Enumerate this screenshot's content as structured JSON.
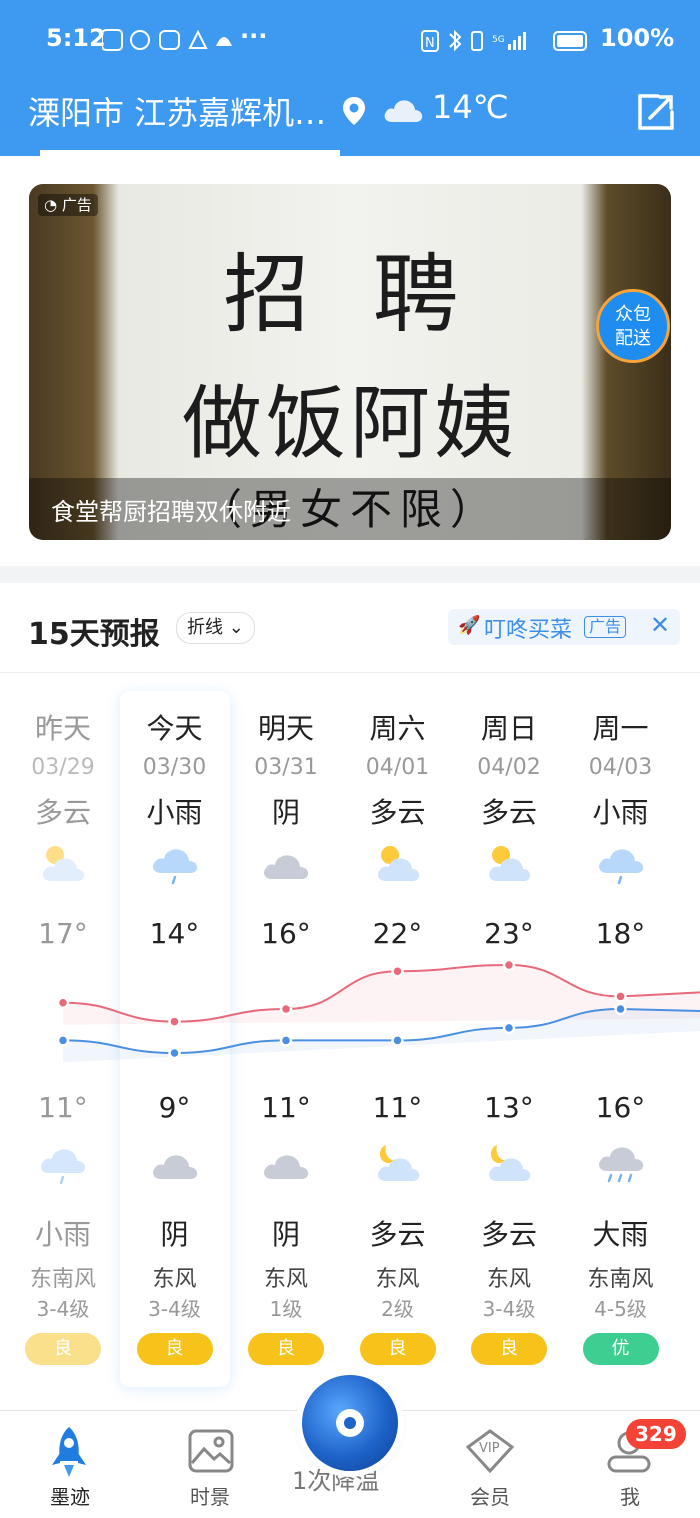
{
  "status_bar": {
    "time": "5:12",
    "more": "···",
    "battery": "100%"
  },
  "header": {
    "location": "溧阳市 江苏嘉辉机…",
    "temperature": "14℃"
  },
  "ad": {
    "tag": "广告",
    "line1": "招  聘",
    "line2": "做饭阿姨",
    "line3": "（男女不限）",
    "caption": "食堂帮厨招聘双休附近",
    "badge_line1": "众包",
    "badge_line2": "配送"
  },
  "forecast": {
    "title": "15天预报",
    "view_mode": "折线",
    "promo_text": "叮咚买菜",
    "promo_tag": "广告",
    "days": [
      {
        "name": "昨天",
        "date": "03/29",
        "day_cond": "多云",
        "high": "17°",
        "low": "11°",
        "night_cond": "小雨",
        "wind_dir": "东南风",
        "wind_level": "3-4级",
        "aqi": "良",
        "day_icon": "partly-cloudy-icon",
        "night_icon": "light-rain-icon"
      },
      {
        "name": "今天",
        "date": "03/30",
        "day_cond": "小雨",
        "high": "14°",
        "low": "9°",
        "night_cond": "阴",
        "wind_dir": "东风",
        "wind_level": "3-4级",
        "aqi": "良",
        "day_icon": "light-rain-icon",
        "night_icon": "overcast-icon"
      },
      {
        "name": "明天",
        "date": "03/31",
        "day_cond": "阴",
        "high": "16°",
        "low": "11°",
        "night_cond": "阴",
        "wind_dir": "东风",
        "wind_level": "1级",
        "aqi": "良",
        "day_icon": "overcast-icon",
        "night_icon": "overcast-icon"
      },
      {
        "name": "周六",
        "date": "04/01",
        "day_cond": "多云",
        "high": "22°",
        "low": "11°",
        "night_cond": "多云",
        "wind_dir": "东风",
        "wind_level": "2级",
        "aqi": "良",
        "day_icon": "partly-cloudy-icon",
        "night_icon": "cloudy-night-icon"
      },
      {
        "name": "周日",
        "date": "04/02",
        "day_cond": "多云",
        "high": "23°",
        "low": "13°",
        "night_cond": "多云",
        "wind_dir": "东风",
        "wind_level": "3-4级",
        "aqi": "良",
        "day_icon": "partly-cloudy-icon",
        "night_icon": "cloudy-night-icon"
      },
      {
        "name": "周一",
        "date": "04/03",
        "day_cond": "小雨",
        "high": "18°",
        "low": "16°",
        "night_cond": "大雨",
        "wind_dir": "东南风",
        "wind_level": "4-5级",
        "aqi": "优",
        "day_icon": "light-rain-icon",
        "night_icon": "heavy-rain-icon"
      }
    ]
  },
  "chart_data": {
    "type": "line",
    "categories": [
      "03/29",
      "03/30",
      "03/31",
      "04/01",
      "04/02",
      "04/03"
    ],
    "series": [
      {
        "values": [
          17,
          14,
          16,
          22,
          23,
          18
        ],
        "color": "#e8697a"
      },
      {
        "values": [
          11,
          9,
          11,
          11,
          13,
          16
        ],
        "color": "#4a90e2"
      }
    ]
  },
  "colors": {
    "brand": "#3d9af0",
    "aqi_good": "#f7c21a",
    "aqi_excellent": "#3ccf91"
  },
  "nav": {
    "items": [
      {
        "label": "墨迹",
        "icon": "rocket-icon"
      },
      {
        "label": "时景",
        "icon": "image-icon"
      },
      {
        "label": "会员",
        "icon": "vip-icon"
      },
      {
        "label": "我",
        "icon": "user-icon"
      }
    ],
    "center_text": "1次降温",
    "badge": "329"
  }
}
